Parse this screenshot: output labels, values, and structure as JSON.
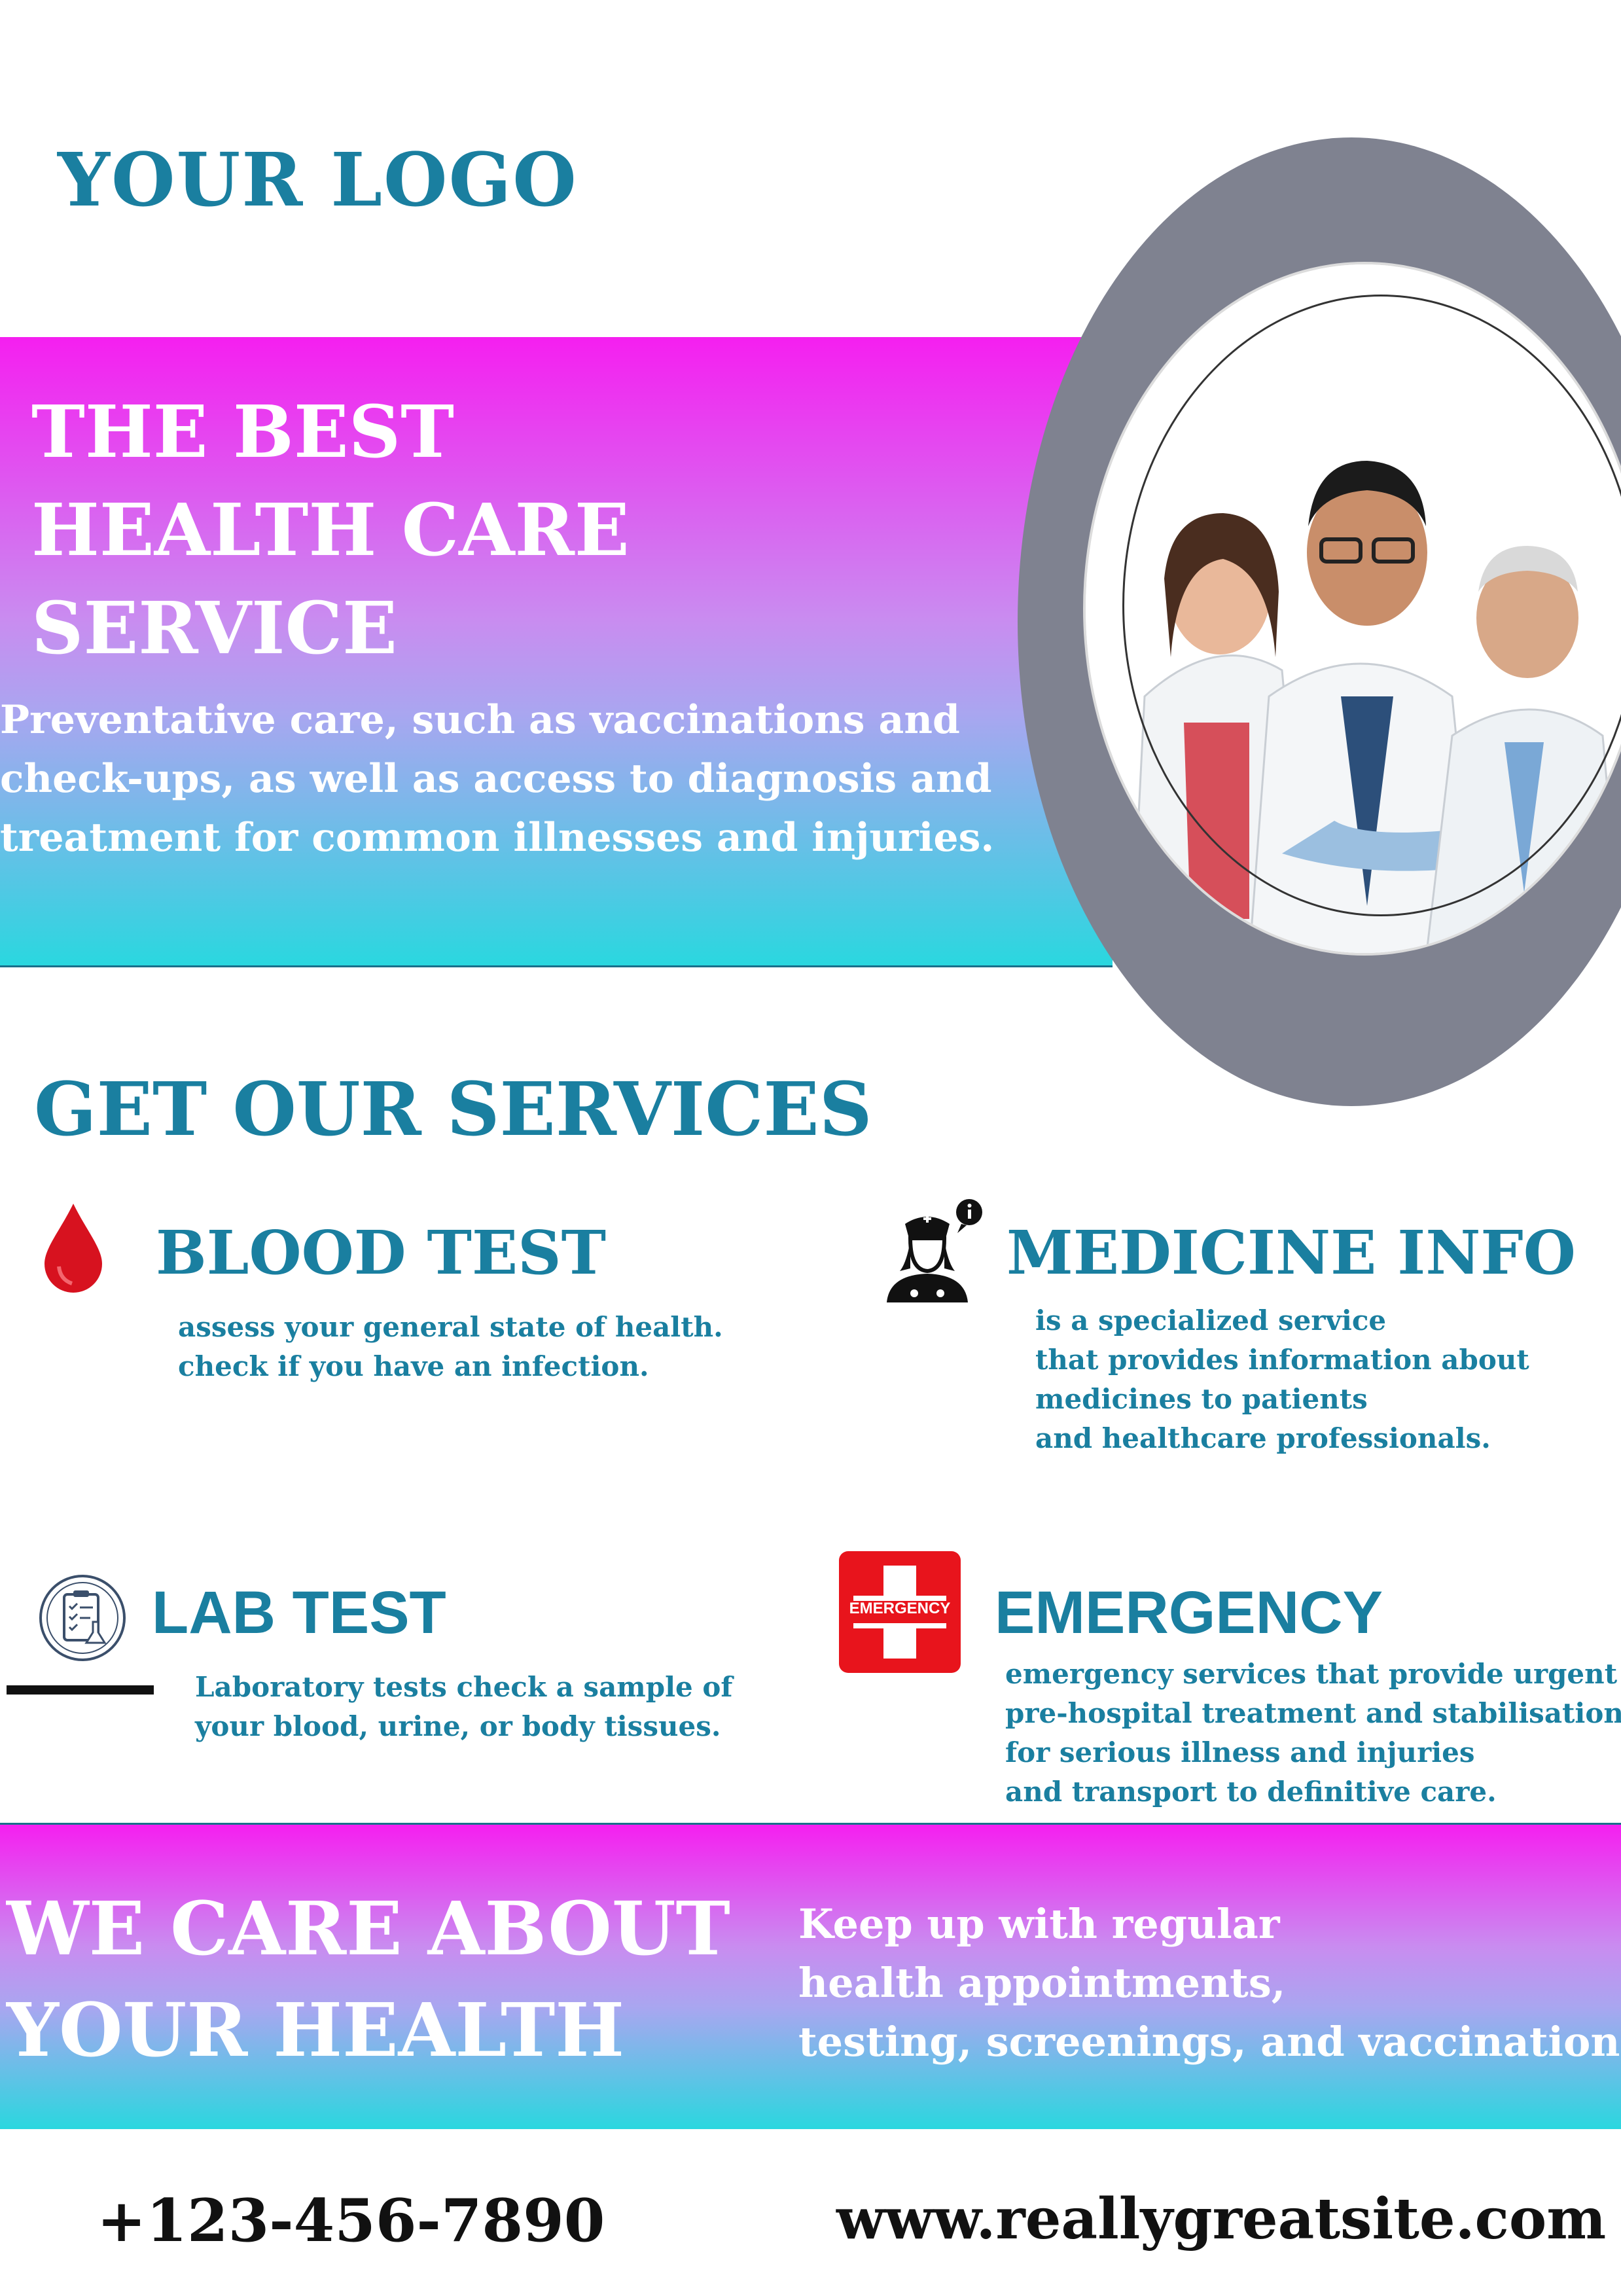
{
  "logo": "YOUR LOGO",
  "hero": {
    "title_lines": [
      "THE BEST",
      "HEALTH CARE",
      "SERVICE"
    ],
    "description_lines": [
      "Preventative care, such as vaccinations and",
      "check-ups, as well as access to diagnosis and",
      " treatment for common illnesses and injuries."
    ]
  },
  "services": {
    "title": "GET OUR SERVICES",
    "items": [
      {
        "title": "BLOOD TEST",
        "lines": [
          "assess your general state of health.",
          "check if you have an infection."
        ]
      },
      {
        "title": "MEDICINE INFO",
        "lines": [
          "is a specialized service",
          "that provides information about",
          "medicines to patients",
          "and healthcare professionals."
        ]
      },
      {
        "title": "LAB TEST",
        "lines": [
          "Laboratory tests check a sample of",
          "your blood, urine, or body tissues."
        ]
      },
      {
        "title": "EMERGENCY",
        "badge": "EMERGENCY",
        "lines": [
          "emergency services that provide urgent",
          "pre-hospital treatment and stabilisation",
          "for serious illness and injuries",
          "and transport to definitive care."
        ]
      }
    ]
  },
  "care": {
    "title_lines": [
      "WE CARE ABOUT",
      "YOUR HEALTH"
    ],
    "text_lines": [
      "Keep up with regular",
      "health appointments,",
      "testing, screenings, and vaccinations."
    ]
  },
  "contact": {
    "phone": "+123-456-7890",
    "website": "www.reallygreatsite.com"
  },
  "colors": {
    "accent": "#1a7fa0",
    "band_top": "#f51ff0",
    "band_bottom": "#2ad7df",
    "ring": "#7f8290",
    "emergency_red": "#e8141c"
  },
  "icons": [
    "blood-drop-icon",
    "nurse-info-icon",
    "lab-report-icon",
    "emergency-cross-icon"
  ]
}
